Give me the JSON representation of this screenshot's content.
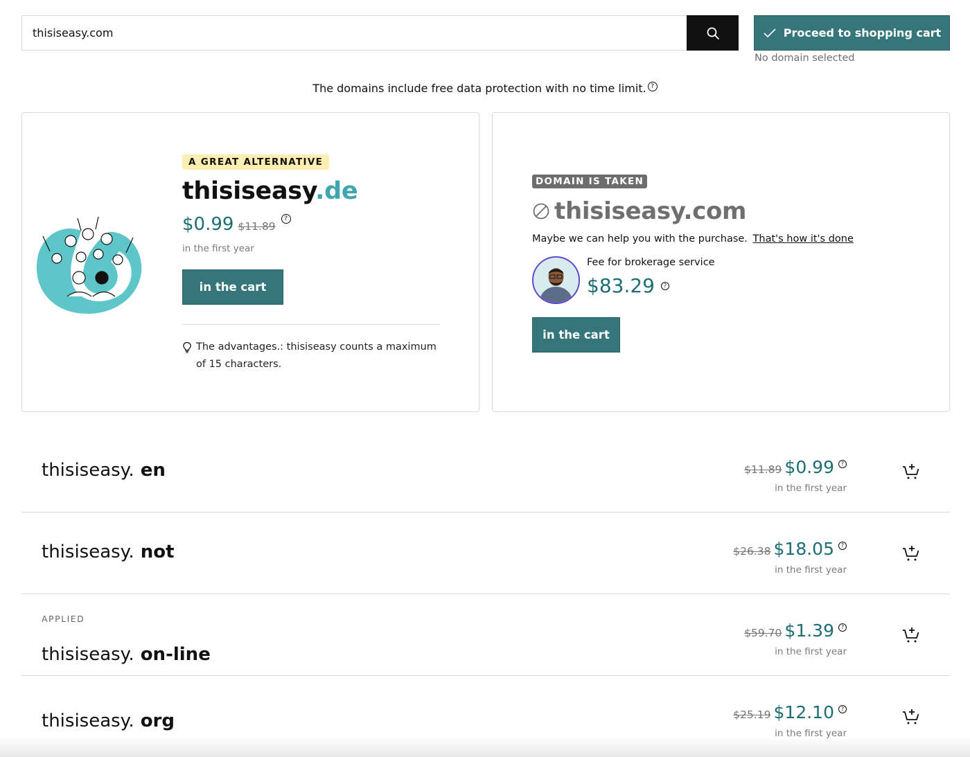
{
  "search": {
    "value": "thisiseasy.com",
    "button_icon": "search-icon"
  },
  "cart": {
    "proceed_label": "Proceed to shopping cart",
    "status": "No domain selected"
  },
  "protection_note": "The domains include free data protection with no time limit.",
  "help_glyph": "?",
  "alternative": {
    "badge": "A GREAT ALTERNATIVE",
    "name": "thisiseasy",
    "tld": ".de",
    "price": "$0.99",
    "old_price": "$11.89",
    "period": "in the first year",
    "cart_label": "in the cart",
    "tip": "The advantages.: thisiseasy counts a maximum of 15 characters."
  },
  "taken": {
    "badge": "DOMAIN IS TAKEN",
    "domain": "thisiseasy.com",
    "help_text": "Maybe we can help you with the purchase.",
    "help_link": "That's how it's done",
    "fee_label": "Fee for brokerage service",
    "fee_price": "$83.29",
    "cart_label": "in the cart"
  },
  "domains": [
    {
      "label": "",
      "name": "thisiseasy.",
      "tld": " en",
      "old_price": "$11.89",
      "price": "$0.99",
      "period": "in the first year"
    },
    {
      "label": "",
      "name": "thisiseasy.",
      "tld": " not",
      "old_price": "$26.38",
      "price": "$18.05",
      "period": "in the first year"
    },
    {
      "label": "APPLIED",
      "name": "thisiseasy.",
      "tld": " on-line",
      "old_price": "$59.70",
      "price": "$1.39",
      "period": "in the first year"
    },
    {
      "label": "",
      "name": "thisiseasy.",
      "tld": " org",
      "old_price": "$25.19",
      "price": "$12.10",
      "period": "in the first year"
    }
  ],
  "colors": {
    "accent": "#35767a",
    "price": "#1c6e73",
    "tld": "#3fa5ae",
    "badge_alt_bg": "#fceeb0",
    "badge_taken_bg": "#6d6d6d"
  }
}
